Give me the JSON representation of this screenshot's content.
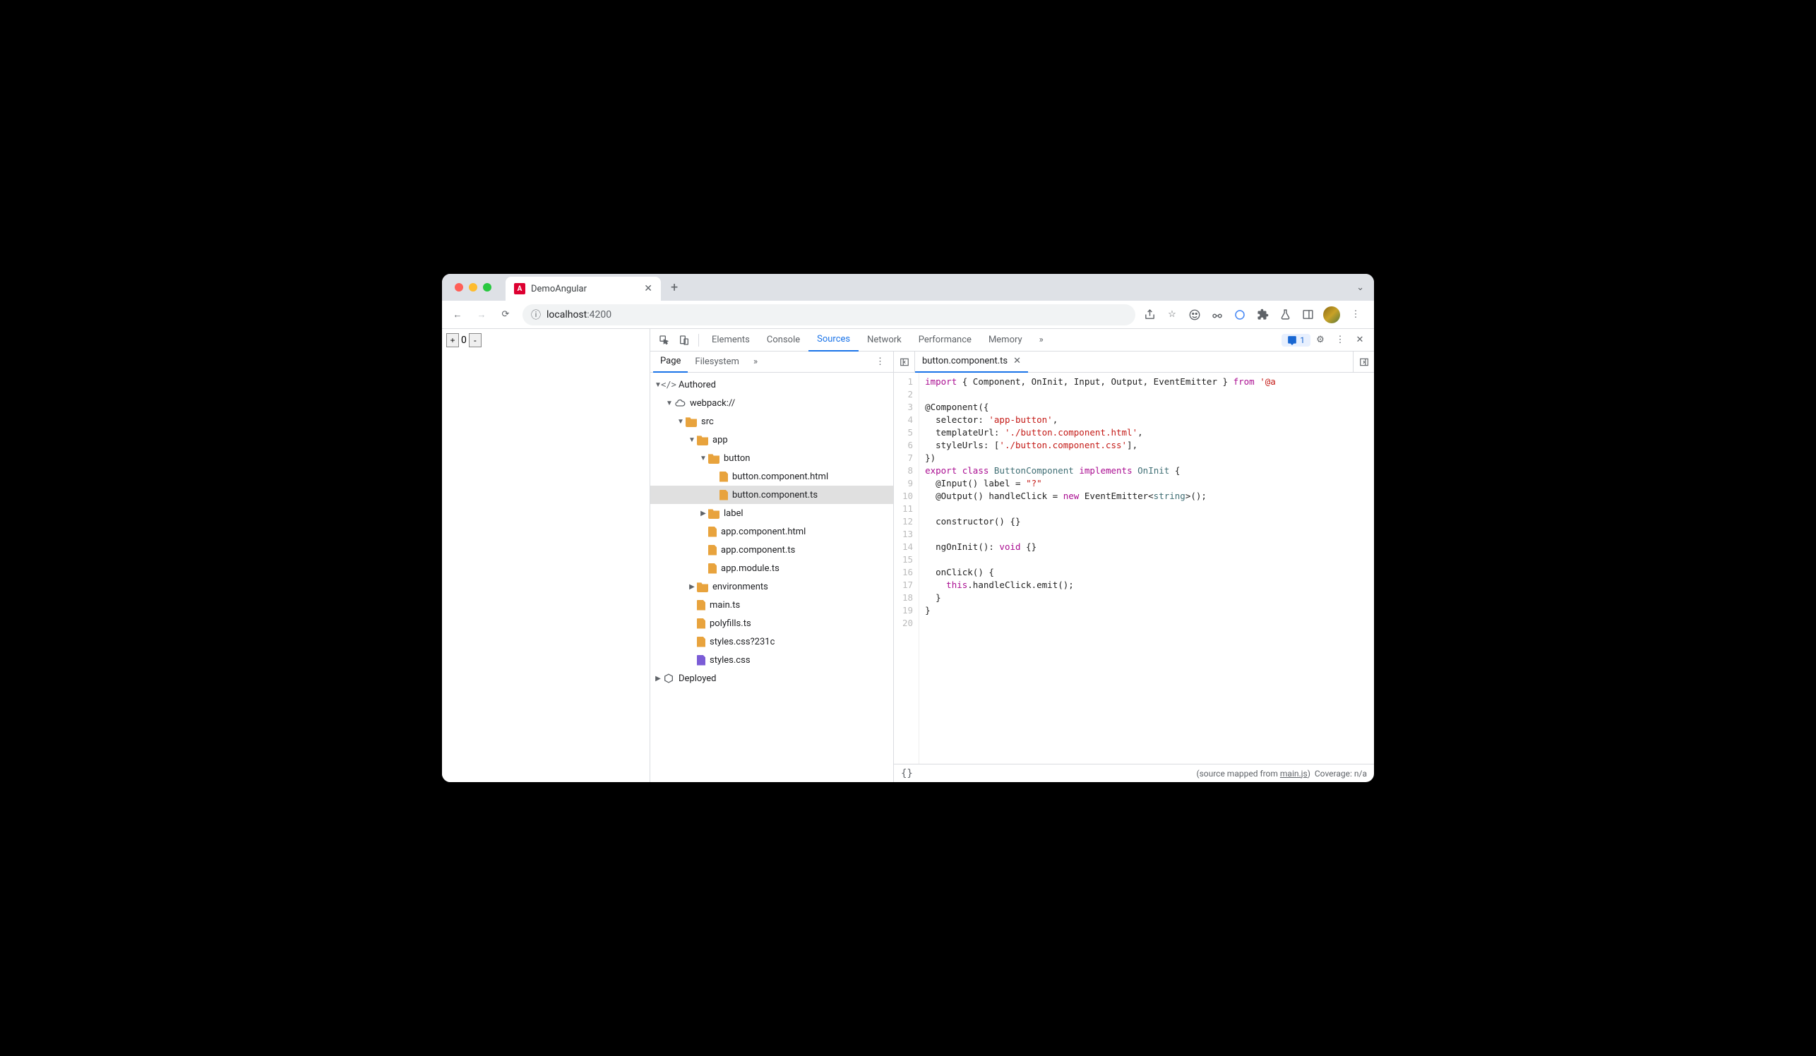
{
  "browser": {
    "tab_title": "DemoAngular",
    "url_host": "localhost",
    "url_port": ":4200"
  },
  "page": {
    "counter_value": "0",
    "plus": "+",
    "minus": "-"
  },
  "devtools": {
    "tabs": [
      "Elements",
      "Console",
      "Sources",
      "Network",
      "Performance",
      "Memory"
    ],
    "active_tab": "Sources",
    "more": "»",
    "issues_count": "1"
  },
  "sources_nav": {
    "tabs": [
      "Page",
      "Filesystem"
    ],
    "active": "Page",
    "more": "»"
  },
  "tree": {
    "authored": "Authored",
    "webpack": "webpack://",
    "src": "src",
    "app": "app",
    "button": "button",
    "button_html": "button.component.html",
    "button_ts": "button.component.ts",
    "label": "label",
    "app_html": "app.component.html",
    "app_ts": "app.component.ts",
    "app_module": "app.module.ts",
    "environments": "environments",
    "main": "main.ts",
    "polyfills": "polyfills.ts",
    "styles_q": "styles.css?231c",
    "styles": "styles.css",
    "deployed": "Deployed"
  },
  "editor": {
    "open_file": "button.component.ts",
    "lines": [
      {
        "n": 1,
        "html": "<span class='kw'>import</span> { Component, OnInit, Input, Output, EventEmitter } <span class='kw'>from</span> <span class='str'>'@a</span>"
      },
      {
        "n": 2,
        "html": ""
      },
      {
        "n": 3,
        "html": "@Component({"
      },
      {
        "n": 4,
        "html": "  selector: <span class='str'>'app-button'</span>,"
      },
      {
        "n": 5,
        "html": "  templateUrl: <span class='str'>'./button.component.html'</span>,"
      },
      {
        "n": 6,
        "html": "  styleUrls: [<span class='str'>'./button.component.css'</span>],"
      },
      {
        "n": 7,
        "html": "})"
      },
      {
        "n": 8,
        "html": "<span class='kw'>export</span> <span class='kw'>class</span> <span class='cls'>ButtonComponent</span> <span class='kw'>implements</span> <span class='cls'>OnInit</span> {"
      },
      {
        "n": 9,
        "html": "  @Input() label = <span class='str'>\"?\"</span>"
      },
      {
        "n": 10,
        "html": "  @Output() handleClick = <span class='kw'>new</span> EventEmitter&lt;<span class='typ'>string</span>&gt;();"
      },
      {
        "n": 11,
        "html": ""
      },
      {
        "n": 12,
        "html": "  constructor() {}"
      },
      {
        "n": 13,
        "html": ""
      },
      {
        "n": 14,
        "html": "  ngOnInit(): <span class='kw'>void</span> {}"
      },
      {
        "n": 15,
        "html": ""
      },
      {
        "n": 16,
        "html": "  onClick() {"
      },
      {
        "n": 17,
        "html": "    <span class='kw'>this</span>.handleClick.emit();"
      },
      {
        "n": 18,
        "html": "  }"
      },
      {
        "n": 19,
        "html": "}"
      },
      {
        "n": 20,
        "html": ""
      }
    ]
  },
  "statusbar": {
    "braces": "{}",
    "mapped_prefix": "(source mapped from ",
    "mapped_link": "main.js",
    "mapped_suffix": ")",
    "coverage": "Coverage: n/a"
  }
}
